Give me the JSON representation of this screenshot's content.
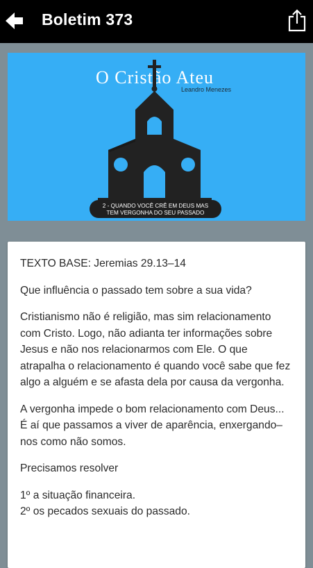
{
  "header": {
    "title": "Boletim 373",
    "back_icon": "arrow-left-icon",
    "share_icon": "share-icon"
  },
  "banner": {
    "title": "O Cristão Ateu",
    "author": "Leandro Menezes",
    "caption_line1": "2 - QUANDO VOCÊ CRÊ EM DEUS MAS",
    "caption_line2": "TEM VERGONHA DO SEU PASSADO",
    "background_color": "#36aef5"
  },
  "content": {
    "base_label": "TEXTO BASE:",
    "base_ref": " Jeremias 29.13–14",
    "question": "Que influência o passado tem sobre a sua vida?",
    "paragraph1": "Cristianismo não é religião, mas sim relacionamento com Cristo. Logo, não adianta ter informações sobre Jesus e não nos relacionarmos com Ele. O que atrapalha o relacionamento é quando você sabe que fez algo a alguém e se afasta dela por causa da vergonha.",
    "paragraph2": "A vergonha impede o bom relacionamento com Deus... É aí que passamos a viver de aparência, enxergando–nos como não somos.",
    "resolver": "Precisamos resolver",
    "list": [
      "1º a situação financeira.",
      "2º os pecados sexuais do passado."
    ]
  }
}
